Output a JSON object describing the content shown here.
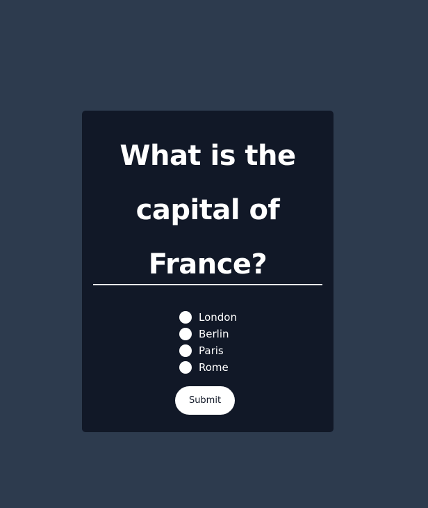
{
  "quiz": {
    "question": "What is the capital of France?",
    "options": [
      {
        "label": "London"
      },
      {
        "label": "Berlin"
      },
      {
        "label": "Paris"
      },
      {
        "label": "Rome"
      }
    ],
    "submit_label": "Submit"
  },
  "colors": {
    "page_background": "#2d3b4e",
    "card_background": "#111827",
    "text": "#ffffff",
    "button_background": "#ffffff",
    "button_text": "#111827"
  }
}
